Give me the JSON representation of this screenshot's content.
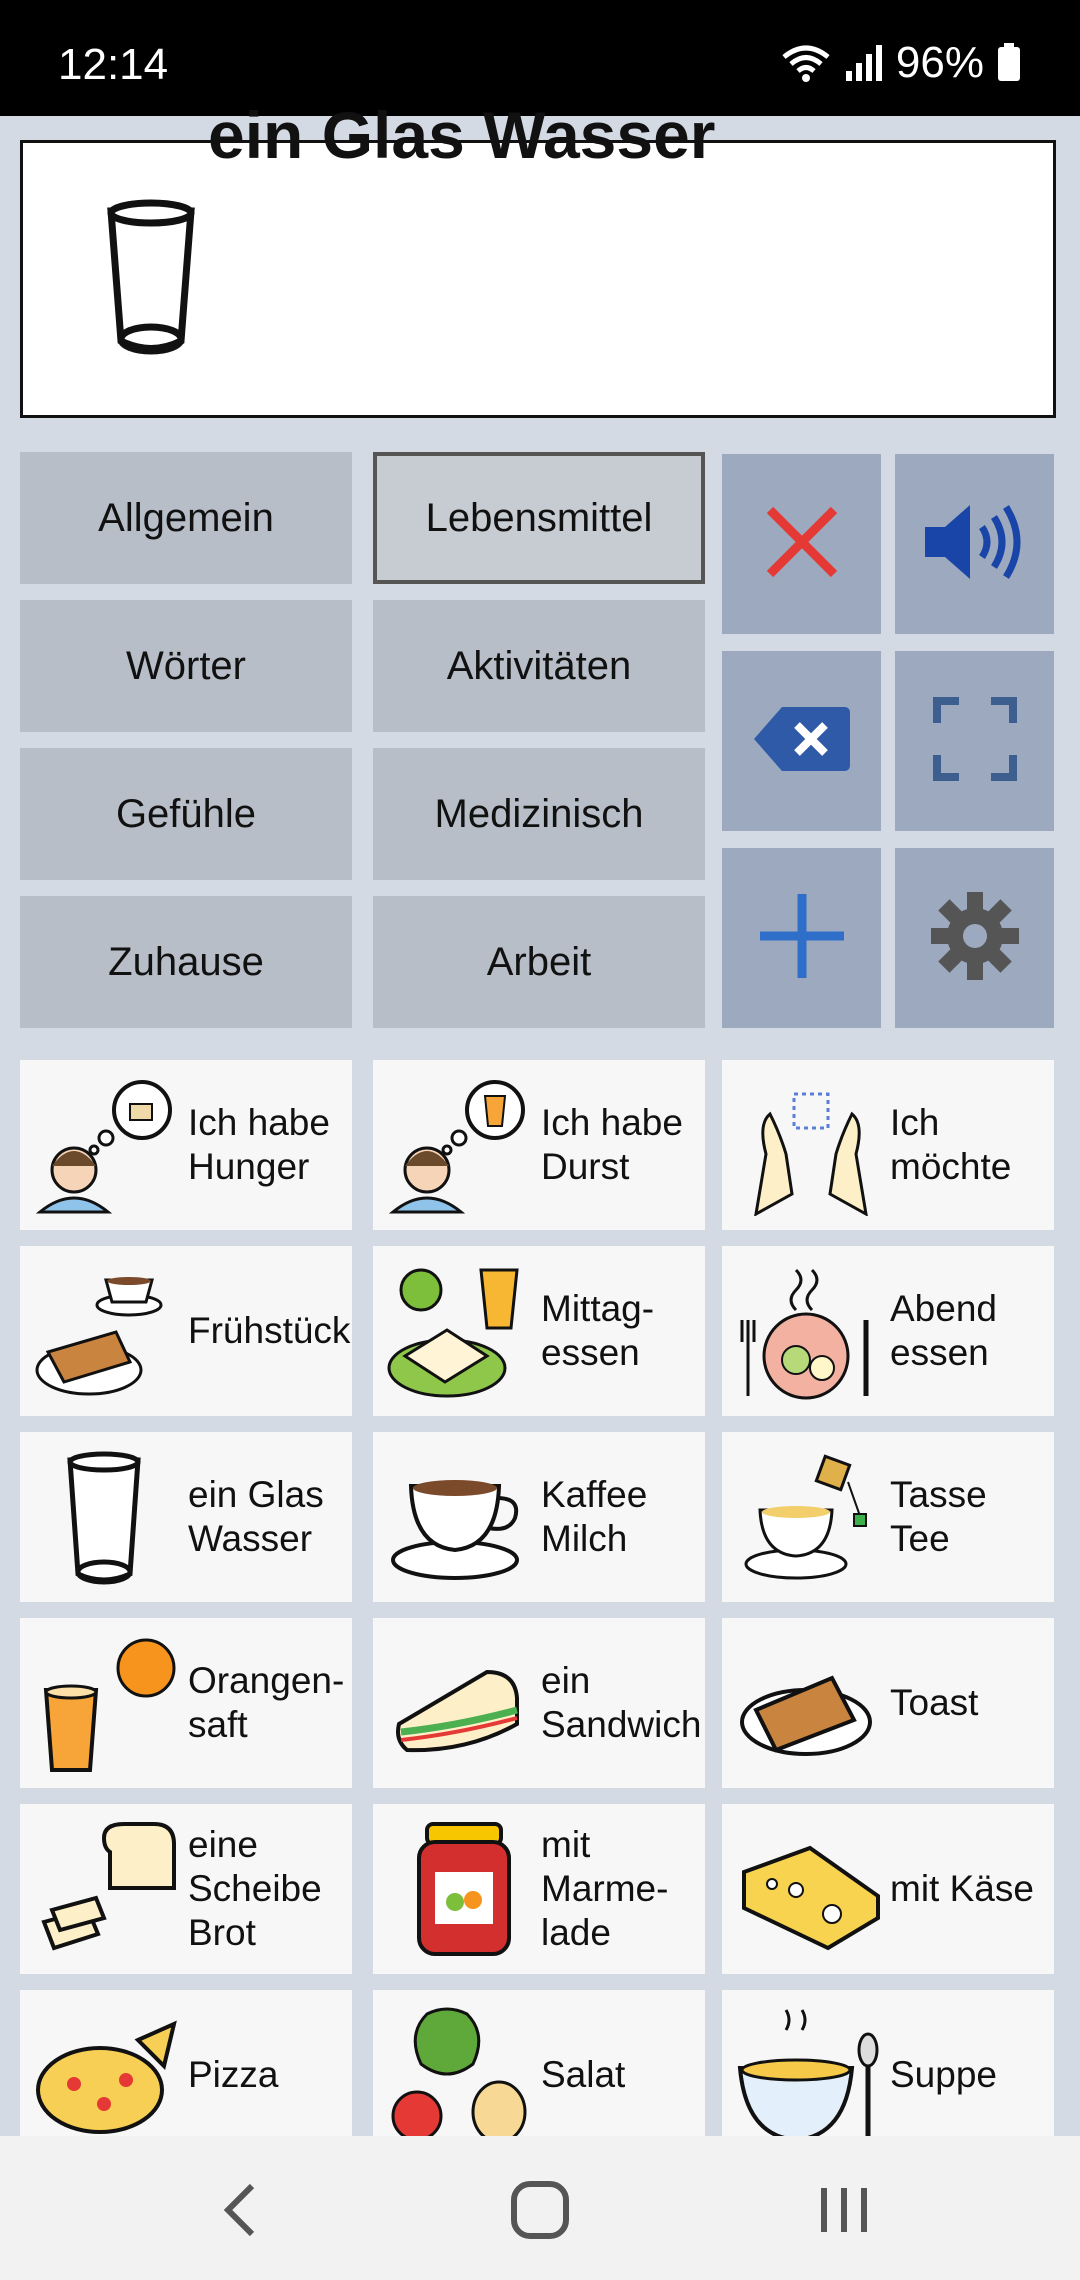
{
  "status": {
    "time": "12:14",
    "battery": "96%",
    "icons": [
      "wifi-icon",
      "signal-icon",
      "battery-icon"
    ]
  },
  "message": {
    "text": "ein Glas Wasser",
    "icon": "glass-icon"
  },
  "categories": [
    {
      "label": "Allgemein",
      "active": false
    },
    {
      "label": "Lebensmittel",
      "active": true
    },
    {
      "label": "Wörter",
      "active": false
    },
    {
      "label": "Aktivitäten",
      "active": false
    },
    {
      "label": "Gefühle",
      "active": false
    },
    {
      "label": "Medizinisch",
      "active": false
    },
    {
      "label": "Zuhause",
      "active": false
    },
    {
      "label": "Arbeit",
      "active": false
    }
  ],
  "controls": [
    "close-icon",
    "speaker-icon",
    "backspace-icon",
    "fullscreen-icon",
    "add-icon",
    "gear-icon"
  ],
  "tiles": [
    {
      "label": "Ich habe\nHunger",
      "icon": "hungry-person-icon"
    },
    {
      "label": "Ich habe\nDurst",
      "icon": "thirsty-person-icon"
    },
    {
      "label": "Ich\nmöchte",
      "icon": "hands-want-icon"
    },
    {
      "label": "Frühstück",
      "icon": "breakfast-icon"
    },
    {
      "label": "Mittag-\nessen",
      "icon": "lunch-icon"
    },
    {
      "label": "Abend\nessen",
      "icon": "dinner-icon"
    },
    {
      "label": "ein Glas\nWasser",
      "icon": "glass-icon"
    },
    {
      "label": "Kaffee\nMilch",
      "icon": "coffee-cup-icon"
    },
    {
      "label": "Tasse\nTee",
      "icon": "tea-cup-icon"
    },
    {
      "label": "Orangen-\nsaft",
      "icon": "orange-juice-icon"
    },
    {
      "label": "ein\nSandwich",
      "icon": "sandwich-icon"
    },
    {
      "label": "Toast",
      "icon": "toast-icon"
    },
    {
      "label": "eine\nScheibe\nBrot",
      "icon": "bread-icon"
    },
    {
      "label": "mit\nMarme-\nlade",
      "icon": "jam-jar-icon"
    },
    {
      "label": "mit Käse",
      "icon": "cheese-icon"
    },
    {
      "label": "Pizza",
      "icon": "pizza-icon"
    },
    {
      "label": "Salat",
      "icon": "salad-icon"
    },
    {
      "label": "Suppe",
      "icon": "soup-icon"
    }
  ],
  "navbar": [
    "back-icon",
    "home-icon",
    "recents-icon"
  ],
  "colors": {
    "accent": "#9ca9bf",
    "category": "#b8bec8",
    "background": "#d3dae3",
    "close": "#e53935",
    "speaker": "#1a45a8"
  }
}
